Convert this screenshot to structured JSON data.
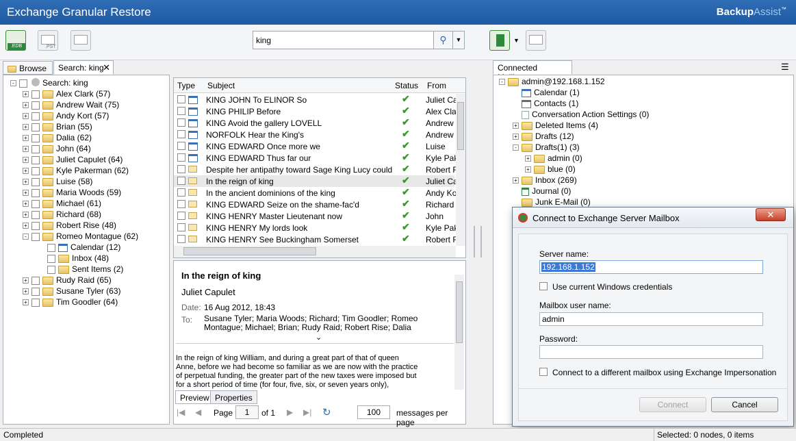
{
  "app": {
    "title": "Exchange Granular Restore",
    "brand1": "Backup",
    "brand2": "Assist",
    "tm": "™"
  },
  "toolbar": {
    "search_value": "king",
    "edb_label": ".EDB",
    "pst_label": ".PST"
  },
  "left_tabs": {
    "browse": "Browse",
    "search": "Search: king"
  },
  "search_tree": {
    "root": "Search: king",
    "nodes": [
      "Alex Clark (57)",
      "Andrew Wait (75)",
      "Andy Kort (57)",
      "Brian (55)",
      "Dalia (62)",
      "John (64)",
      "Juliet Capulet (64)",
      "Kyle Pakerman (62)",
      "Luise (58)",
      "Maria Woods (59)",
      "Michael (61)",
      "Richard (68)",
      "Robert Rise (48)",
      "Romeo Montague (62)"
    ],
    "romeo_children": [
      "Calendar (12)",
      "Inbox (48)",
      "Sent Items (2)"
    ],
    "tail_nodes": [
      "Rudy Raid (65)",
      "Susane Tyler (63)",
      "Tim Goodler (64)"
    ]
  },
  "grid": {
    "headers": [
      "Type",
      "Subject",
      "Status",
      "From"
    ],
    "rows": [
      {
        "type": "cal",
        "subject": "KING JOHN To ELINOR So",
        "from": "Juliet Ca"
      },
      {
        "type": "cal",
        "subject": "KING PHILIP Before",
        "from": "Alex Clar"
      },
      {
        "type": "cal",
        "subject": "KING Avoid the gallery LOVELL",
        "from": "Andrew '"
      },
      {
        "type": "cal",
        "subject": "NORFOLK Hear the King's",
        "from": "Andrew '"
      },
      {
        "type": "cal",
        "subject": "KING EDWARD Once more we",
        "from": "Luise"
      },
      {
        "type": "cal",
        "subject": "KING EDWARD Thus far our",
        "from": "Kyle Pak"
      },
      {
        "type": "env",
        "subject": "Despite her antipathy toward Sage King Lucy could",
        "from": "Robert F"
      },
      {
        "type": "env",
        "subject": "In the reign of king",
        "from": "Juliet Ca"
      },
      {
        "type": "env",
        "subject": "In the ancient dominions of the king",
        "from": "Andy Ko"
      },
      {
        "type": "env",
        "subject": "KING EDWARD Seize on the shame-fac'd",
        "from": "Richard"
      },
      {
        "type": "env",
        "subject": "KING HENRY Master Lieutenant now",
        "from": "John"
      },
      {
        "type": "env",
        "subject": "KING HENRY My lords look",
        "from": "Kyle Pak"
      },
      {
        "type": "env",
        "subject": "KING HENRY See Buckingham Somerset",
        "from": "Robert F"
      }
    ]
  },
  "preview": {
    "subject": "In the reign of king",
    "sender": "Juliet Capulet",
    "date_label": "Date:",
    "date": "16 Aug 2012, 18:43",
    "to_label": "To:",
    "to1": "Susane Tyler; Maria Woods; Richard; Tim Goodler; Romeo",
    "to2": "Montague; Michael; Brian; Rudy Raid; Robert Rise; Dalia",
    "body1": "In the reign of king William, and during a great part of that of queen",
    "body2": "Anne, before we had become so familiar as we are now with the practice",
    "body3": "of perpetual funding, the greater part of the new taxes were imposed but",
    "body4": "for a short period of time (for four, five, six, or seven years only),",
    "tab_preview": "Preview",
    "tab_properties": "Properties"
  },
  "pager": {
    "page_label": "Page",
    "page": "1",
    "of": "of 1",
    "per_page": "100",
    "per_page_label": "messages per page"
  },
  "right": {
    "tab": "Connected Mailboxes",
    "root": "admin@192.168.1.152",
    "items": [
      "Calendar (1)",
      "Contacts (1)",
      "Conversation Action Settings (0)",
      "Deleted Items (4)",
      "Drafts (12)",
      "Drafts(1) (3)",
      "admin (0)",
      "blue (0)",
      "Inbox (269)",
      "Journal (0)",
      "Junk E-Mail (0)"
    ]
  },
  "dialog": {
    "title": "Connect to Exchange Server Mailbox",
    "server_label": "Server name:",
    "server_value": "192.168.1.152",
    "use_windows": "Use current Windows credentials",
    "user_label": "Mailbox user name:",
    "user_value": "admin",
    "password_label": "Password:",
    "impersonation": "Connect to a different mailbox using Exchange Impersonation",
    "connect": "Connect",
    "cancel": "Cancel"
  },
  "status": {
    "left": "Completed",
    "right": "Selected: 0 nodes, 0 items"
  }
}
